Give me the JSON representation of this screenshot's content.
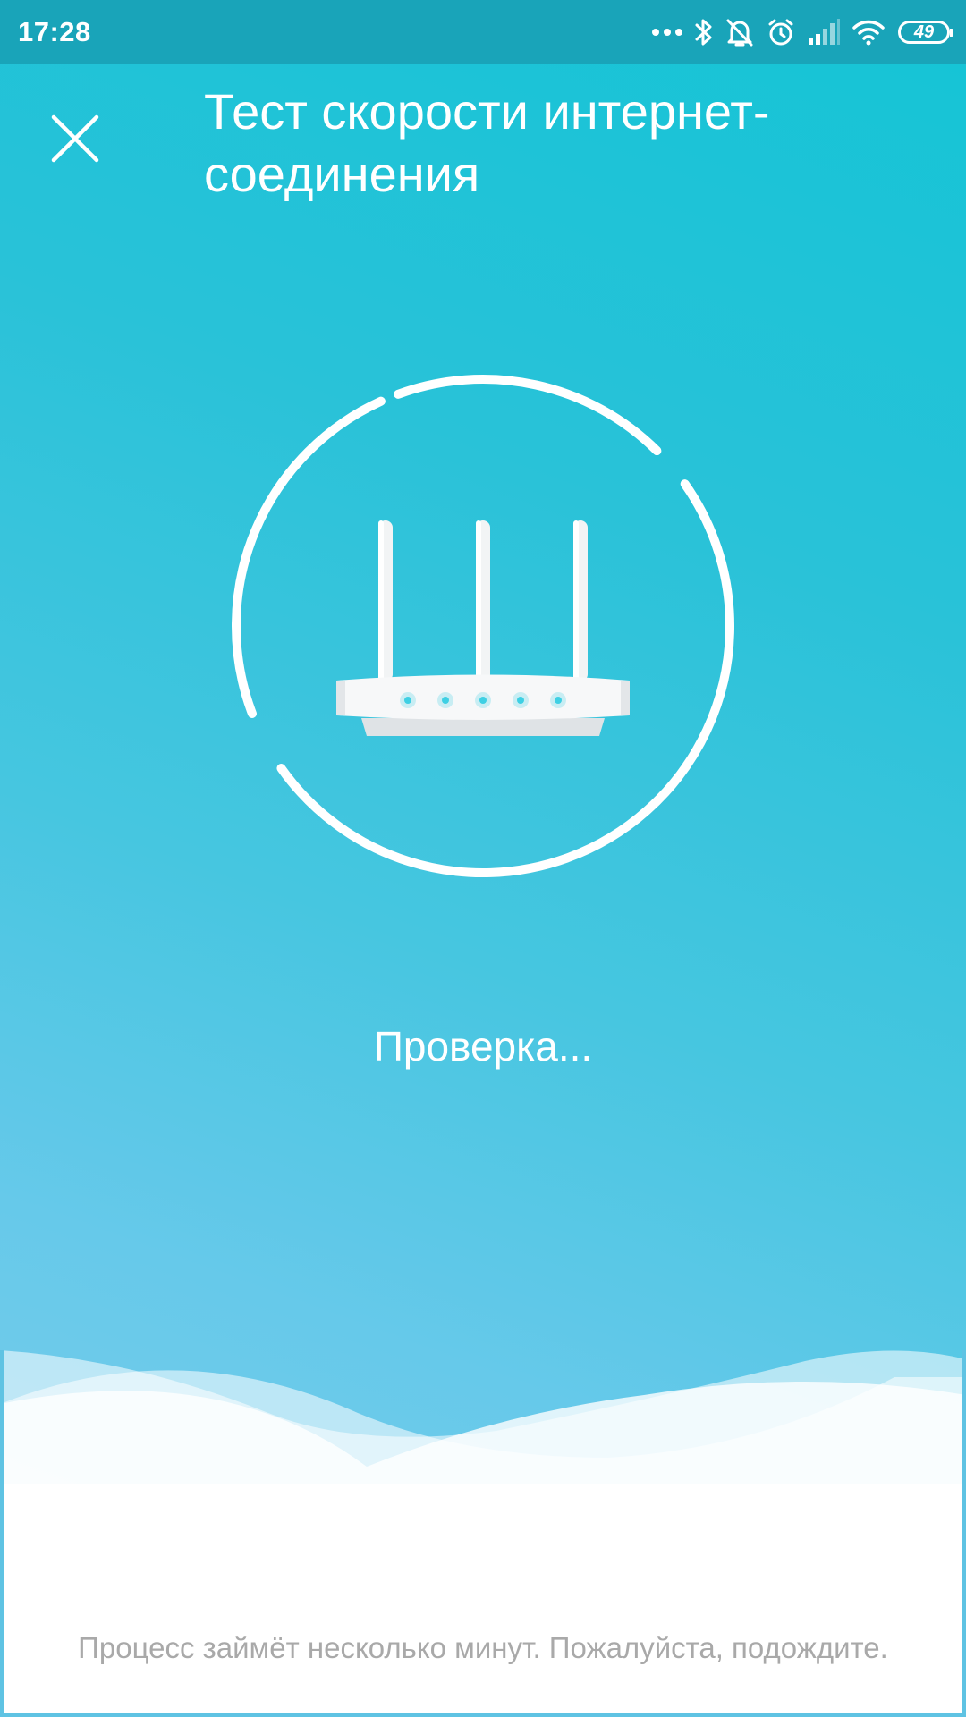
{
  "status_bar": {
    "time": "17:28",
    "battery_level": "49",
    "icons": [
      "more-dots-icon",
      "bluetooth-icon",
      "silent-mode-icon",
      "alarm-icon",
      "signal-icon",
      "wifi-icon",
      "battery-icon"
    ]
  },
  "header": {
    "close_icon": "close-icon",
    "title": "Тест скорости интернет-соединения"
  },
  "main": {
    "illustration": "router-icon",
    "status": "Проверка...",
    "hint": "Процесс займёт несколько минут. Пожалуйста, подождите."
  },
  "colors": {
    "status_bar": "#19a4b9",
    "gradient_top": "#14c4d6",
    "gradient_bottom": "#7fcdea",
    "text_light": "#ffffff",
    "hint_text": "#a9a9a9",
    "router_led": "#3ed0e4"
  }
}
